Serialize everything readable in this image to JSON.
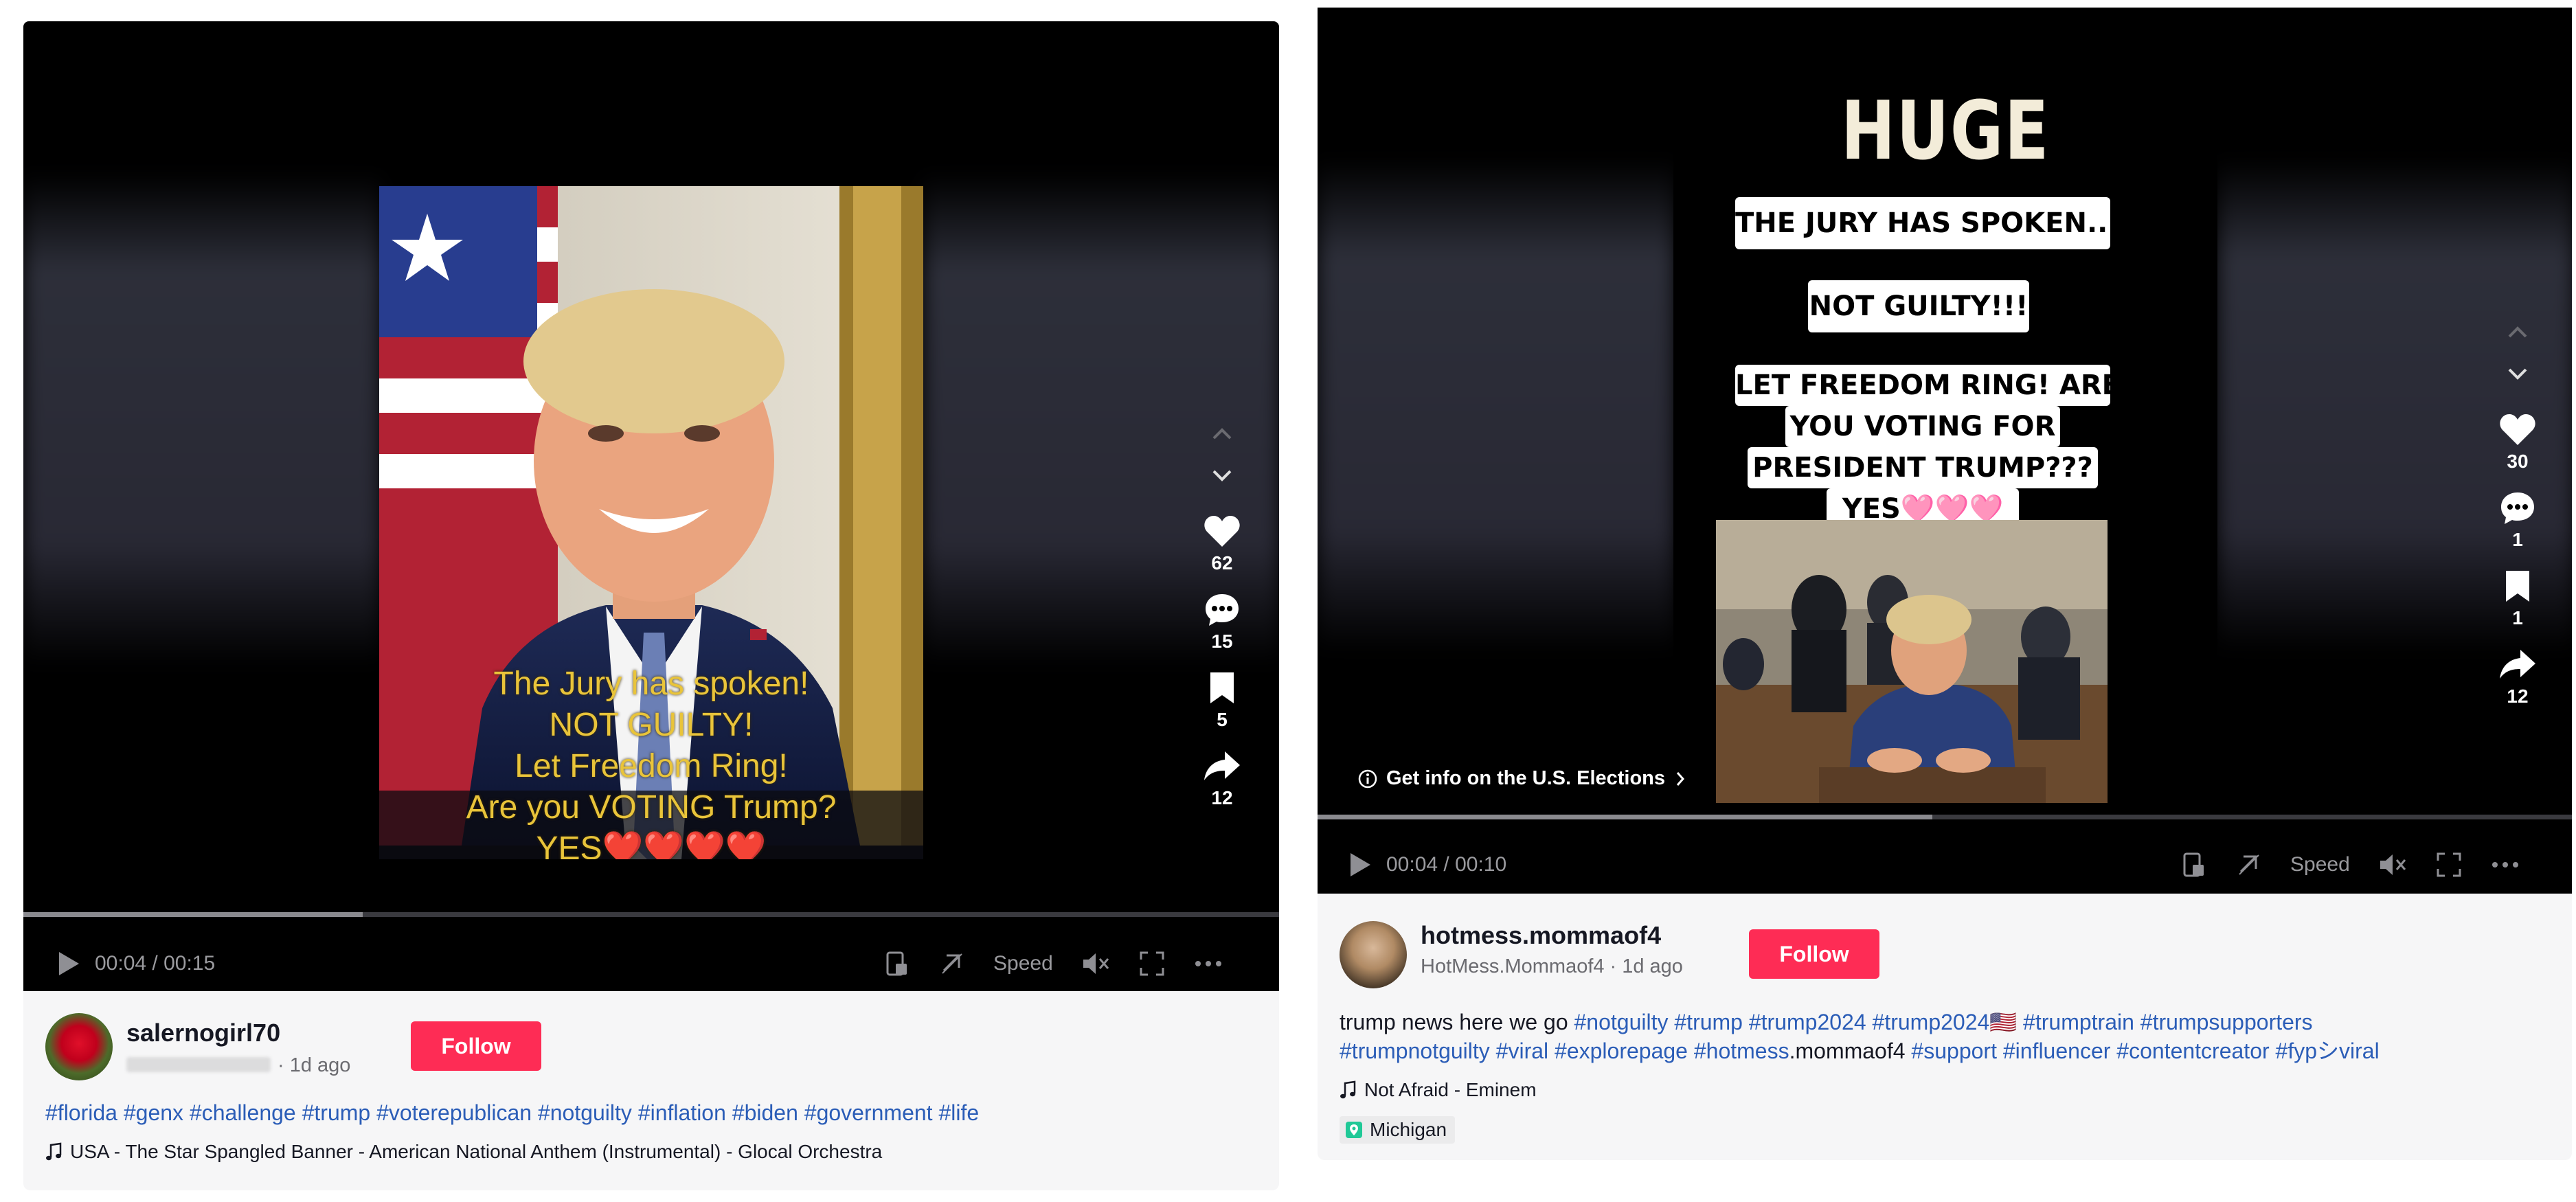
{
  "colors": {
    "follow": "#fe2c55",
    "hashtag": "#2b5db7",
    "background": "#ffffff",
    "meta_bg": "#f6f6f7"
  },
  "left": {
    "video": {
      "overlay_lines": [
        "The Jury has spoken!",
        "NOT GUILTY!",
        "Let Freedom Ring!",
        "Are you VOTING Trump?",
        "YES❤️❤️❤️❤️"
      ],
      "time": "00:04 / 00:15",
      "progress": 0.27,
      "speed_label": "Speed"
    },
    "actions": {
      "likes": "62",
      "comments": "15",
      "saves": "5",
      "shares": "12"
    },
    "author": {
      "username": "salernogirl70",
      "date": "· 1d ago",
      "follow_label": "Follow"
    },
    "hashtags": [
      "#florida",
      "#genx",
      "#challenge",
      "#trump",
      "#voterepublican",
      "#notguilty",
      "#inflation",
      "#biden",
      "#government",
      "#life"
    ],
    "music": "USA - The Star Spangled Banner - American National Anthem (Instrumental) - Glocal Orchestra"
  },
  "right": {
    "video": {
      "huge": "HUGE",
      "box1": "THE JURY HAS SPOKEN...",
      "box2": "NOT GUILTY!!!",
      "box3_lines": [
        "LET FREEDOM RING! ARE",
        "YOU VOTING FOR",
        "PRESIDENT TRUMP???",
        "YES🩷🩷🩷"
      ],
      "elections_label": "Get info on the U.S. Elections",
      "time": "00:04 / 00:10",
      "progress": 0.49,
      "speed_label": "Speed"
    },
    "actions": {
      "likes": "30",
      "comments": "1",
      "saves": "1",
      "shares": "12"
    },
    "author": {
      "username": "hotmess.mommaof4",
      "nickname": "HotMess.Mommaof4",
      "date": "· 1d ago",
      "follow_label": "Follow"
    },
    "caption_lead": "trump news here we go",
    "hashtags_line1": [
      "#notguilty",
      "#trump",
      "#trump2024",
      "#trump2024🇺🇸",
      "#trumptrain",
      "#trumpsupporters"
    ],
    "hashtags_line2_a": [
      "#trumpnotguilty",
      "#viral",
      "#explorepage",
      "#hotmess"
    ],
    "hashtags_line2_plain": ".mommaof4",
    "hashtags_line2_b": [
      "#support",
      "#influencer",
      "#contentcreator",
      "#fypシviral"
    ],
    "music": "Not Afraid - Eminem",
    "location": "Michigan"
  }
}
